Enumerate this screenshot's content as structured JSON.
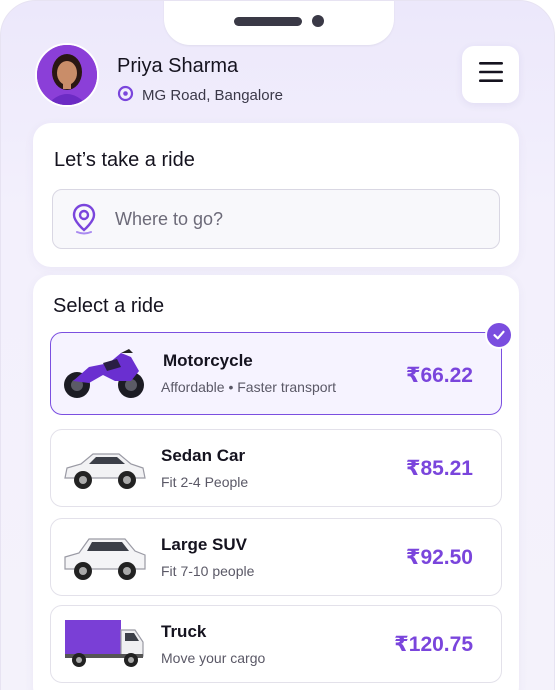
{
  "user": {
    "name": "Priya Sharma",
    "location": "MG Road, Bangalore"
  },
  "search": {
    "title": "Let’s take a ride",
    "placeholder": "Where to go?"
  },
  "rides": {
    "title": "Select a ride",
    "items": [
      {
        "name": "Motorcycle",
        "desc": "Affordable • Faster transport",
        "price": "₹66.22",
        "selected": true,
        "icon": "motorcycle-image"
      },
      {
        "name": "Sedan Car",
        "desc": "Fit 2-4 People",
        "price": "₹85.21",
        "selected": false,
        "icon": "sedan-image"
      },
      {
        "name": "Large SUV",
        "desc": "Fit 7-10 people",
        "price": "₹92.50",
        "selected": false,
        "icon": "suv-image"
      },
      {
        "name": "Truck",
        "desc": "Move your cargo",
        "price": "₹120.75",
        "selected": false,
        "icon": "truck-image"
      }
    ]
  },
  "colors": {
    "accent": "#7a45dc",
    "background": "#f1eefb",
    "card": "#ffffff"
  }
}
